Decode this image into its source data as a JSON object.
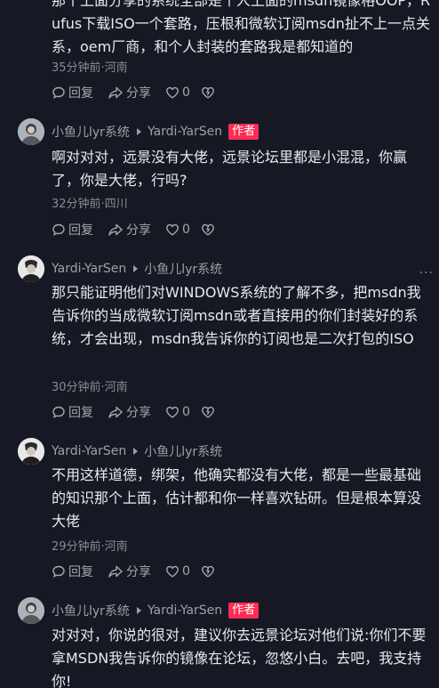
{
  "top_comment": {
    "text": "那个上面分享的系统全部是个人上面的msdn镜像格OOP，Rufus下载ISO一个套路，压根和微软订阅msdn扯不上一点关系，oem厂商，和个人封装的套路我是都知道的",
    "time_location": "35分钟前·河南",
    "actions": {
      "reply": "回复",
      "share": "分享",
      "like_count": "0"
    }
  },
  "comments": [
    {
      "user": "小鱼儿lyr系统",
      "reply_to": "Yardi-YarSen",
      "badge": "作者",
      "text": "啊对对对，远景没有大佬，远景论坛里都是小混混，你赢了，你是大佬，行吗?",
      "time_location": "32分钟前·四川",
      "actions": {
        "reply": "回复",
        "share": "分享",
        "like_count": "0"
      }
    },
    {
      "user": "Yardi-YarSen",
      "reply_to": "小鱼儿lyr系统",
      "badge": "",
      "more": "...",
      "text": "那只能证明他们对WINDOWS系统的了解不多，把msdn我告诉你的当成微软订阅msdn或者直接用的你们封装好的系统，才会出现，msdn我告诉你的订阅也是二次打包的ISO",
      "time_location": "30分钟前·河南",
      "actions": {
        "reply": "回复",
        "share": "分享",
        "like_count": "0"
      }
    },
    {
      "user": "Yardi-YarSen",
      "reply_to": "小鱼儿lyr系统",
      "badge": "",
      "text": "不用这样道德，绑架，他确实都没有大佬，都是一些最基础的知识那个上面，估计都和你一样喜欢钻研。但是根本算没大佬",
      "time_location": "29分钟前·河南",
      "actions": {
        "reply": "回复",
        "share": "分享",
        "like_count": "0"
      }
    },
    {
      "user": "小鱼儿lyr系统",
      "reply_to": "Yardi-YarSen",
      "badge": "作者",
      "text": "对对对，你说的很对，建议你去远景论坛对他们说:你们不要拿MSDN我告诉你的镜像在论坛，忽悠小白。去吧，我支持你!",
      "time_location": "",
      "actions": {
        "reply": "",
        "share": "",
        "like_count": ""
      }
    }
  ],
  "colors": {
    "background": "#161823",
    "author_badge": "#fe2c55",
    "meta_text": "#9fa0a6"
  },
  "icons": [
    "reply-icon",
    "share-icon",
    "like-icon",
    "dislike-icon",
    "play-arrow-icon",
    "more-icon"
  ]
}
